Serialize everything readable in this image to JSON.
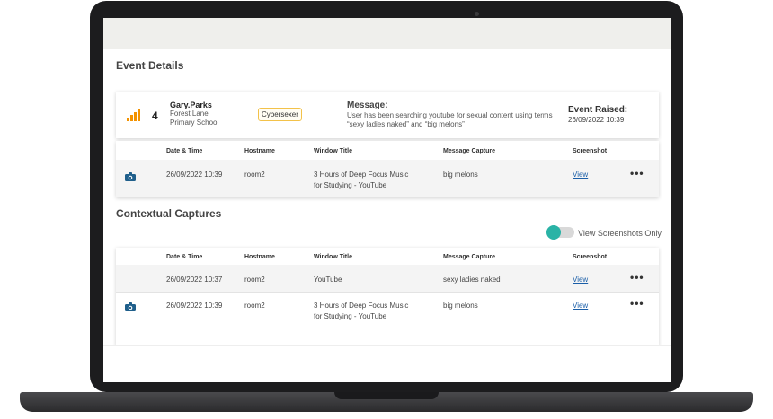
{
  "event_details": {
    "title": "Event Details",
    "severity_level": 4,
    "user": "Gary.Parks",
    "school_line1": "Forest Lane",
    "school_line2": "Primary School",
    "category": "Cybersexer",
    "message_label": "Message:",
    "message_text": "User has been searching youtube for sexual content using terms “sexy ladies naked” and “big melons”",
    "raised_label": "Event Raised:",
    "raised_date": "26/09/2022 10:39"
  },
  "table_headers": {
    "datetime": "Date & Time",
    "hostname": "Hostname",
    "window_title": "Window Title",
    "message_capture": "Message Capture",
    "screenshot": "Screenshot"
  },
  "event_row": {
    "datetime": "26/09/2022 10:39",
    "hostname": "room2",
    "window_title_1": "3 Hours of Deep Focus Music",
    "window_title_2": "for Studying - YouTube",
    "message_capture": "big melons",
    "screenshot_link": "View",
    "more": "•••"
  },
  "contextual": {
    "title": "Contextual Captures",
    "toggle_label": "View Screenshots Only",
    "toggle_on": true,
    "rows": [
      {
        "datetime": "26/09/2022 10:37",
        "hostname": "room2",
        "window_title_1": "YouTube",
        "window_title_2": "",
        "message_capture": "sexy ladies naked",
        "screenshot_link": "View",
        "more": "•••"
      },
      {
        "datetime": "26/09/2022 10:39",
        "hostname": "room2",
        "window_title_1": "3 Hours of Deep Focus Music",
        "window_title_2": "for Studying - YouTube",
        "message_capture": "big melons",
        "screenshot_link": "View",
        "more": "•••"
      }
    ]
  },
  "colors": {
    "severity": "#f39200",
    "accent": "#2ab3a6",
    "link": "#1a5ea8",
    "camera_icon": "#1f5f8b",
    "tag_border": "#f3c24a"
  },
  "icons": {
    "severity": "signal-bars-icon",
    "screenshot": "camera-icon",
    "more": "more-options-icon"
  }
}
